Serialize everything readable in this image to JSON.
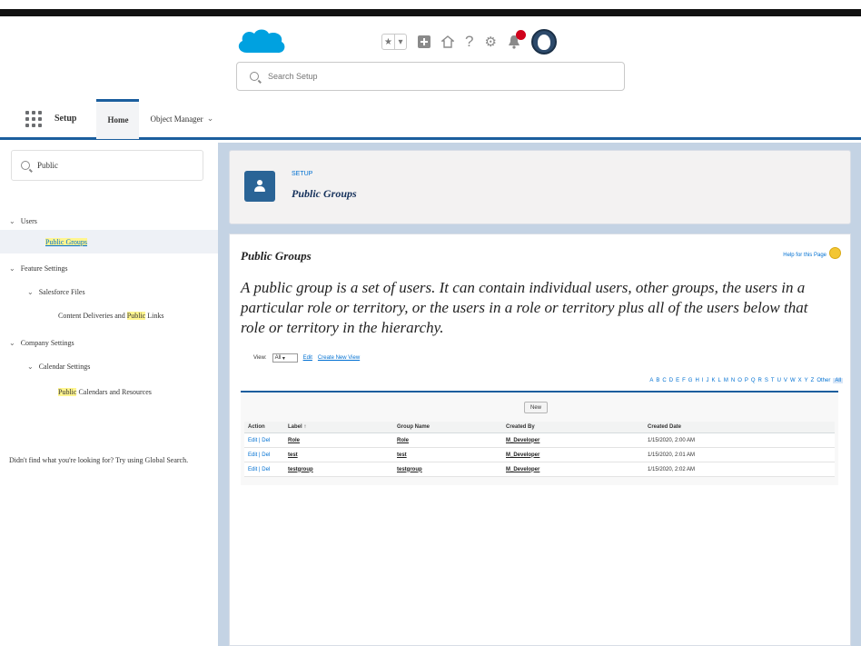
{
  "header": {
    "search_placeholder": "Search Setup",
    "icons": [
      "favorites-star-icon",
      "favorites-list-icon",
      "add-icon",
      "home-icon",
      "help-icon",
      "gear-icon",
      "notification-bell-icon",
      "user-avatar"
    ]
  },
  "navbar": {
    "app_name": "Setup",
    "tabs": [
      {
        "label": "Home",
        "active": true
      },
      {
        "label": "Object Manager",
        "active": false
      }
    ]
  },
  "sidebar": {
    "quickfind_value": "Public",
    "tree": [
      {
        "label": "Users",
        "level": 0,
        "expanded": true
      },
      {
        "label": "Public Groups",
        "level": 2,
        "selected": true
      },
      {
        "label": "Feature Settings",
        "level": 0,
        "expanded": true
      },
      {
        "label": "Salesforce Files",
        "level": 1,
        "expanded": true
      },
      {
        "label_before": "Content Deliveries and ",
        "label_highlight": "Public",
        "label_after": " Links",
        "level": 2
      },
      {
        "label": "Company Settings",
        "level": 0,
        "expanded": true
      },
      {
        "label": "Calendar Settings",
        "level": 1,
        "expanded": true
      },
      {
        "label_before": "",
        "label_highlight": "Public",
        "label_after": " Calendars and Resources",
        "level": 2
      }
    ],
    "note": "Didn't find what you're looking for? Try using Global Search."
  },
  "page_header": {
    "breadcrumb": "SETUP",
    "title": "Public Groups"
  },
  "main": {
    "title": "Public Groups",
    "help_link": "Help for this Page",
    "description": "A public group is a set of users. It can contain individual users, other groups, the users in a particular role or territory, or the users in a role or territory plus all of the users below that role or territory in the hierarchy.",
    "view_label": "View:",
    "view_value": "All",
    "edit_link": "Edit",
    "create_view_link": "Create New View",
    "alphabet": [
      "A",
      "B",
      "C",
      "D",
      "E",
      "F",
      "G",
      "H",
      "I",
      "J",
      "K",
      "L",
      "M",
      "N",
      "O",
      "P",
      "Q",
      "R",
      "S",
      "T",
      "U",
      "V",
      "W",
      "X",
      "Y",
      "Z",
      "Other",
      "All"
    ],
    "new_button": "New",
    "columns": [
      "Action",
      "Label",
      "Group Name",
      "Created By",
      "Created Date"
    ],
    "rows": [
      {
        "action": "Edit | Del",
        "label": "Role",
        "group_name": "Role",
        "created_by": "M_Developer",
        "created_date": "1/15/2020, 2:00 AM"
      },
      {
        "action": "Edit | Del",
        "label": "test",
        "group_name": "test",
        "created_by": "M_Developer",
        "created_date": "1/15/2020, 2:01 AM"
      },
      {
        "action": "Edit | Del",
        "label": "testgroup",
        "group_name": "testgroup",
        "created_by": "M_Developer",
        "created_date": "1/15/2020, 2:02 AM"
      }
    ]
  },
  "colors": {
    "brand": "#00a1e0",
    "nav_accent": "#1b5e9e",
    "header_badge": "#2a6496",
    "link": "#0070d2",
    "frame": "#c4d3e4",
    "notification": "#d0021b"
  }
}
